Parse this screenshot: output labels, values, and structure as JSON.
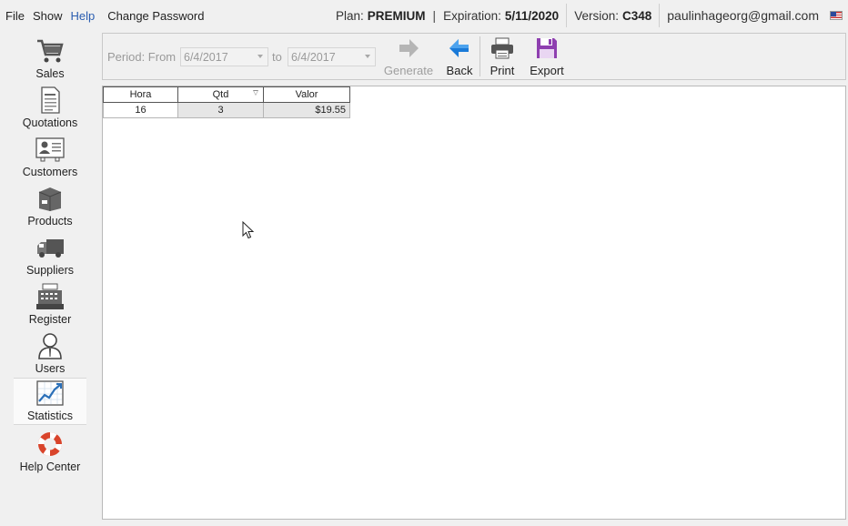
{
  "menu": {
    "file": "File",
    "show": "Show",
    "help": "Help",
    "change_password": "Change Password"
  },
  "plan": {
    "label": "Plan:",
    "value": "PREMIUM"
  },
  "expiration": {
    "label": "Expiration:",
    "value": "5/11/2020"
  },
  "version": {
    "label": "Version:",
    "value": "C348"
  },
  "user_email": "paulinhageorg@gmail.com",
  "flag_icon": "us-flag-icon",
  "sidebar": {
    "items": [
      {
        "label": "Sales",
        "icon": "shopping-cart-icon"
      },
      {
        "label": "Quotations",
        "icon": "document-icon"
      },
      {
        "label": "Customers",
        "icon": "contact-card-icon"
      },
      {
        "label": "Products",
        "icon": "box-icon"
      },
      {
        "label": "Suppliers",
        "icon": "truck-icon"
      },
      {
        "label": "Register",
        "icon": "cash-register-icon"
      },
      {
        "label": "Users",
        "icon": "user-icon"
      },
      {
        "label": "Statistics",
        "icon": "chart-icon"
      },
      {
        "label": "Help Center",
        "icon": "lifebuoy-icon"
      }
    ],
    "active": "Statistics"
  },
  "toolbar": {
    "period_label": "Period: From",
    "from_date": "6/4/2017",
    "to_label": "to",
    "to_date": "6/4/2017",
    "generate_label": "Generate",
    "back_label": "Back",
    "print_label": "Print",
    "export_label": "Export"
  },
  "table": {
    "columns": [
      "Hora",
      "Qtd",
      "Valor"
    ],
    "rows": [
      [
        "16",
        "3",
        "$19.55"
      ]
    ]
  },
  "colors": {
    "accent": "#2a5db0",
    "back_arrow": "#1a7ad8",
    "export_icon": "#8e3fb0",
    "lifebuoy_red": "#d9442b"
  }
}
